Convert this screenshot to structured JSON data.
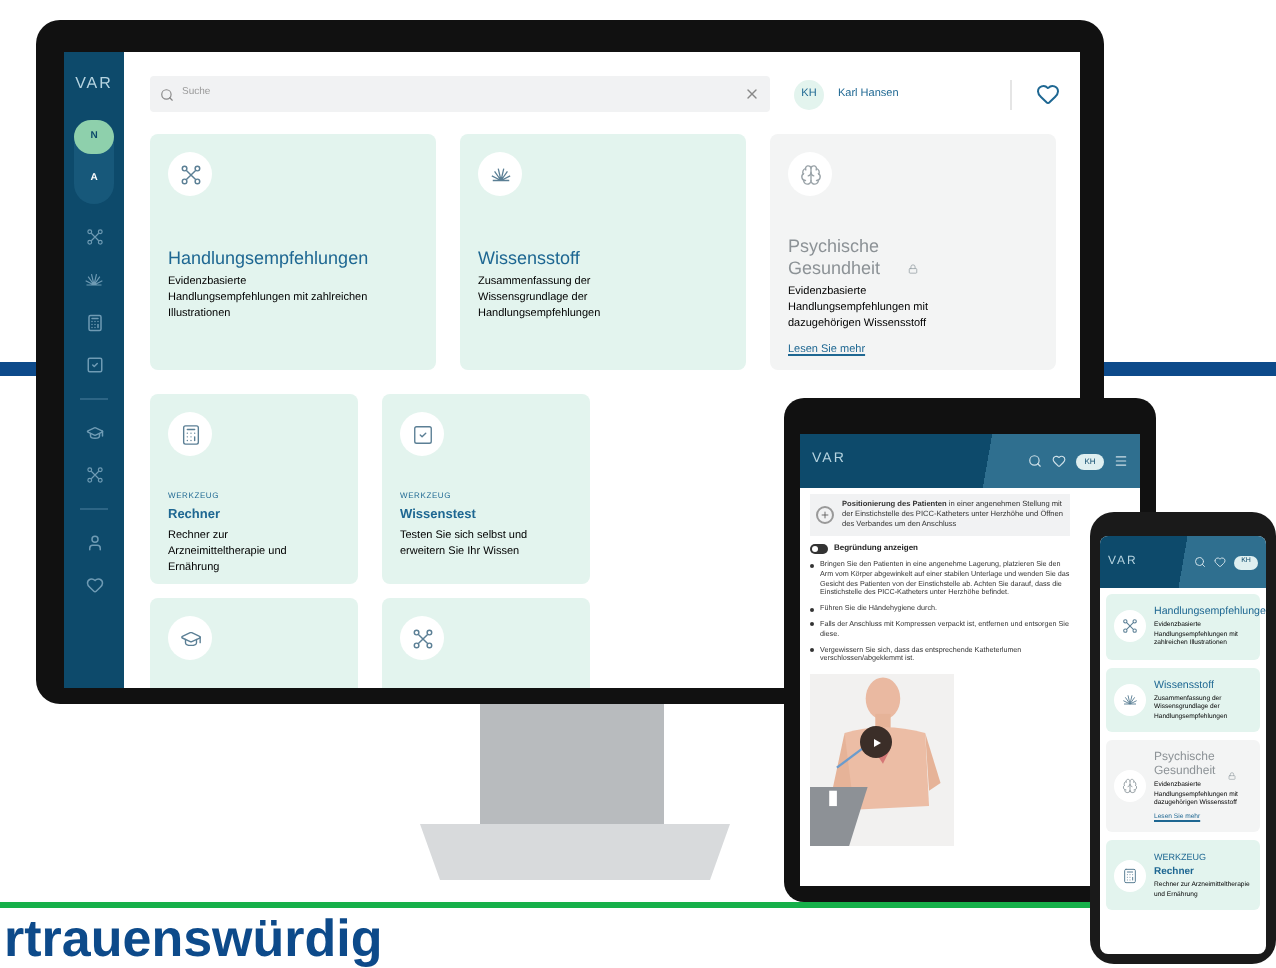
{
  "monitor": {
    "sidebar": {
      "logo": "VAR",
      "mode_toggle": [
        {
          "label": "N",
          "selected": true
        },
        {
          "label": "A",
          "selected": false
        }
      ]
    },
    "search": {
      "placeholder": "Suche"
    },
    "user": {
      "initials": "KH",
      "name": "Karl Hansen"
    },
    "cards": [
      {
        "kind": "topic",
        "title": "Handlungsempfehlungen",
        "description": "Evidenzbasierte Handlungsempfehlungen mit zahlreichen Illustrationen"
      },
      {
        "kind": "topic",
        "title": "Wissensstoff",
        "description": "Zusammenfassung der Wissensgrundlage der Handlungsempfehlungen"
      },
      {
        "kind": "locked",
        "title": "Psychische Gesundheit",
        "description": "Evidenzbasierte Handlungsempfehlungen mit dazugehörigen Wissensstoff",
        "link": "Lesen Sie mehr"
      },
      {
        "kind": "tool",
        "label": "WERKZEUG",
        "title": "Rechner",
        "description": "Rechner zur Arzneimitteltherapie und Ernährung"
      },
      {
        "kind": "tool",
        "label": "WERKZEUG",
        "title": "Wissenstest",
        "description": "Testen Sie sich selbst und erweitern Sie Ihr Wissen"
      },
      {
        "kind": "stub"
      },
      {
        "kind": "stub"
      }
    ]
  },
  "tablet": {
    "logo": "VAR",
    "initials": "KH",
    "step": "**Positionierung des Patienten** in einer angenehmen Stellung mit der Einstichstelle des PICC-Katheters unter Herzhöhe und Öffnen des Verbandes um den Anschluss",
    "reason_toggle": {
      "label": "Begründung anzeigen",
      "on": false
    },
    "bullets": [
      "Bringen Sie den Patienten in eine angenehme Lagerung, platzieren Sie den Arm vom Körper abgewinkelt auf einer stabilen Unterlage und wenden Sie das Gesicht des Patienten von der Einstichstelle ab. Achten Sie darauf, dass die Einstichstelle des PICC-Katheters unter Herzhöhe befindet.",
      "Führen Sie die Händehygiene durch.",
      "Falls der Anschluss mit Kompressen verpackt ist, entfernen und entsorgen Sie diese.",
      "Vergewissern Sie sich, dass das entsprechende Katheterlumen verschlossen/abgeklemmt ist."
    ]
  },
  "phone": {
    "logo": "VAR",
    "initials": "KH",
    "cards": [
      {
        "kind": "topic",
        "title": "Handlungsempfehlunge",
        "description": "Evidenzbasierte Handlungsempfehlungen mit zahlreichen Illustrationen"
      },
      {
        "kind": "topic",
        "title": "Wissensstoff",
        "description": "Zusammenfassung der Wissensgrundlage der Handlungsempfehlungen"
      },
      {
        "kind": "locked",
        "title": "Psychische Gesundheit",
        "description": "Evidenzbasierte Handlungsempfehlungen mit dazugehörigen Wissensstoff",
        "link": "Lesen Sie mehr"
      },
      {
        "kind": "tool",
        "label": "WERKZEUG",
        "title": "Rechner",
        "description": "Rechner zur Arzneimitteltherapie und Ernährung"
      }
    ]
  },
  "headline": "rtrauenswürdig"
}
